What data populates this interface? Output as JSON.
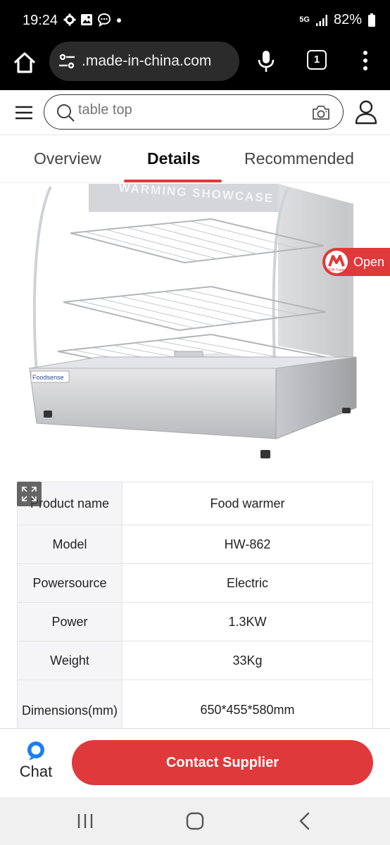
{
  "status_bar": {
    "time": "19:24",
    "network": "5G",
    "battery": "82%"
  },
  "browser": {
    "url": ".made-in-china.com",
    "tab_count": "1"
  },
  "site_header": {
    "search_placeholder": "table top"
  },
  "tabs": [
    {
      "label": "Overview",
      "active": false
    },
    {
      "label": "Details",
      "active": true
    },
    {
      "label": "Recommended",
      "active": false
    }
  ],
  "product_image": {
    "showcase_text": "WARMING SHOWCASE",
    "brand_text": "Foodsense"
  },
  "open_badge": {
    "label": "Open",
    "logo_caption": "B2B Trade"
  },
  "spec_table": {
    "rows": [
      {
        "key": "Product name",
        "value": "Food warmer"
      },
      {
        "key": "Model",
        "value": "HW-862"
      },
      {
        "key": "Powersource",
        "value": "Electric"
      },
      {
        "key": "Power",
        "value": "1.3KW"
      },
      {
        "key": "Weight",
        "value": "33Kg"
      },
      {
        "key": "Dimensions(mm)",
        "value": "650*455*580mm"
      }
    ]
  },
  "action_bar": {
    "chat_label": "Chat",
    "contact_label": "Contact Supplier"
  },
  "colors": {
    "accent": "#e0393b",
    "status_bg": "#000000",
    "table_key_bg": "#f5f5f7"
  }
}
